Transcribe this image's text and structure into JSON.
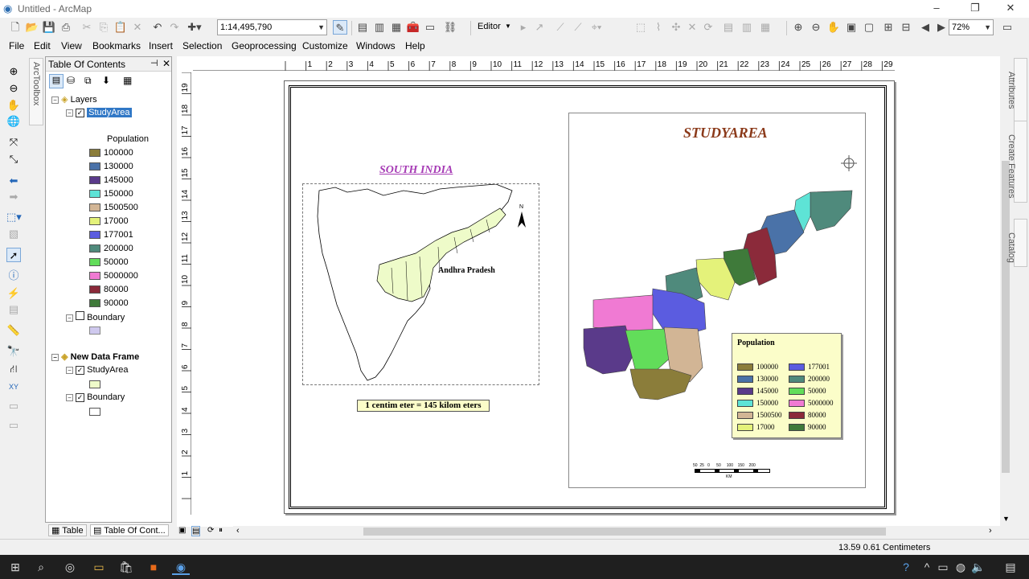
{
  "window": {
    "title": "Untitled - ArcMap"
  },
  "toolbar": {
    "scale": "1:14,495,790",
    "editor": "Editor",
    "zoom": "72%"
  },
  "menu": [
    "File",
    "Edit",
    "View",
    "Bookmarks",
    "Insert",
    "Selection",
    "Geoprocessing",
    "Customize",
    "Windows",
    "Help"
  ],
  "arctoolbox": "ArcToolbox",
  "toc": {
    "title": "Table Of Contents",
    "layers_label": "Layers",
    "study_area": "StudyArea",
    "population_heading": "Population",
    "classes": [
      {
        "label": "100000",
        "color": "#8b7d3a"
      },
      {
        "label": "130000",
        "color": "#4a72a8"
      },
      {
        "label": "145000",
        "color": "#5a3a8a"
      },
      {
        "label": "150000",
        "color": "#5ee3d6"
      },
      {
        "label": "1500500",
        "color": "#d2b595"
      },
      {
        "label": "17000",
        "color": "#e4f27a"
      },
      {
        "label": "177001",
        "color": "#5b5ce0"
      },
      {
        "label": "200000",
        "color": "#4f8a7c"
      },
      {
        "label": "50000",
        "color": "#62dd5a"
      },
      {
        "label": "5000000",
        "color": "#f07ad3"
      },
      {
        "label": "80000",
        "color": "#8b2a3a"
      },
      {
        "label": "90000",
        "color": "#3f7a3a"
      }
    ],
    "boundary": "Boundary",
    "new_frame": "New Data Frame",
    "study_area2": "StudyArea",
    "boundary2": "Boundary",
    "tab_table": "Table",
    "tab_toc": "Table Of Cont..."
  },
  "layout": {
    "inset_title": "SOUTH INDIA",
    "inset_label": "Andhra Pradesh",
    "scale_text": "1 centim eter = 145 kilom eters",
    "main_title": "STUDYAREA",
    "legend_title": "Population",
    "scalebar_ticks": "50  25   0      50     100    150    200",
    "scalebar_unit": "KM"
  },
  "right_tabs": [
    "Attributes",
    "Create Features",
    "Catalog"
  ],
  "status": {
    "coords": "13.59  0.61 Centimeters"
  }
}
